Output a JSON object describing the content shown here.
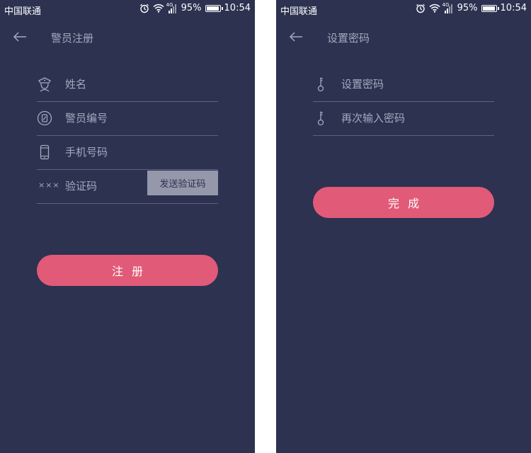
{
  "status_bar": {
    "carrier": "中国联通",
    "battery_percent": "95%",
    "battery_level": 0.95,
    "time": "10:54",
    "network": "4G"
  },
  "register": {
    "title": "警员注册",
    "name_placeholder": "姓名",
    "badge_placeholder": "警员编号",
    "phone_placeholder": "手机号码",
    "code_placeholder": "验证码",
    "code_prefix": "×××",
    "send_code_label": "发送验证码",
    "submit_label": "注册"
  },
  "set_password": {
    "title": "设置密码",
    "password_placeholder": "设置密码",
    "confirm_placeholder": "再次输入密码",
    "submit_label": "完成"
  },
  "colors": {
    "background": "#2c3250",
    "accent": "#e15a78",
    "muted_text": "#a4a9bd",
    "divider": "#5c6280",
    "send_code_bg": "#9598aa"
  },
  "icons": [
    "back-arrow-icon",
    "police-cap-icon",
    "badge-number-icon",
    "mobile-phone-icon",
    "key-icon",
    "alarm-icon",
    "wifi-icon",
    "signal-icon",
    "battery-icon"
  ]
}
